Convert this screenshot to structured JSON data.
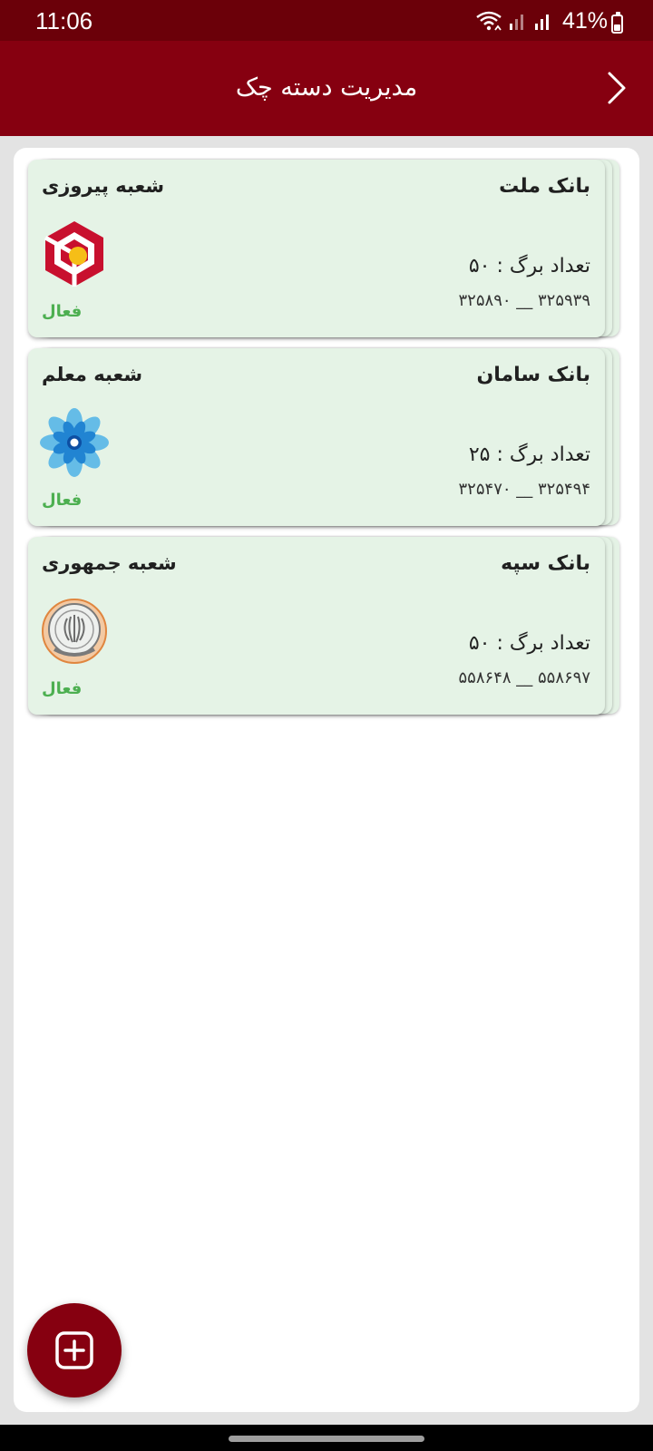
{
  "status_bar": {
    "time": "11:06",
    "battery_percent": "41%",
    "battery_level": 0.41,
    "icons": [
      "wifi-calling-icon",
      "signal-icon",
      "signal-icon"
    ]
  },
  "header": {
    "title": "مدیریت دسته چک",
    "back_icon": "chevron-right-icon"
  },
  "checkbooks": [
    {
      "bank": "بانک ملت",
      "branch": "شعبه پیروزی",
      "leaves": "تعداد برگ : ۵۰",
      "serial_range": "۳۲۵۹۳۹ __ ۳۲۵۸۹۰",
      "status": "فعال",
      "logo": "mellat-logo"
    },
    {
      "bank": "بانک سامان",
      "branch": "شعبه معلم",
      "leaves": "تعداد برگ : ۲۵",
      "serial_range": "۳۲۵۴۹۴ __ ۳۲۵۴۷۰",
      "status": "فعال",
      "logo": "saman-logo"
    },
    {
      "bank": "بانک سپه",
      "branch": "شعبه جمهوری",
      "leaves": "تعداد برگ : ۵۰",
      "serial_range": "۵۵۸۶۹۷ __ ۵۵۸۶۴۸",
      "status": "فعال",
      "logo": "sepah-logo"
    }
  ],
  "fab": {
    "icon": "add-square-icon"
  },
  "colors": {
    "status_bar": "#6b0009",
    "app_bar": "#860010",
    "card_bg": "#e5f3e6",
    "active_green": "#4caf50"
  }
}
